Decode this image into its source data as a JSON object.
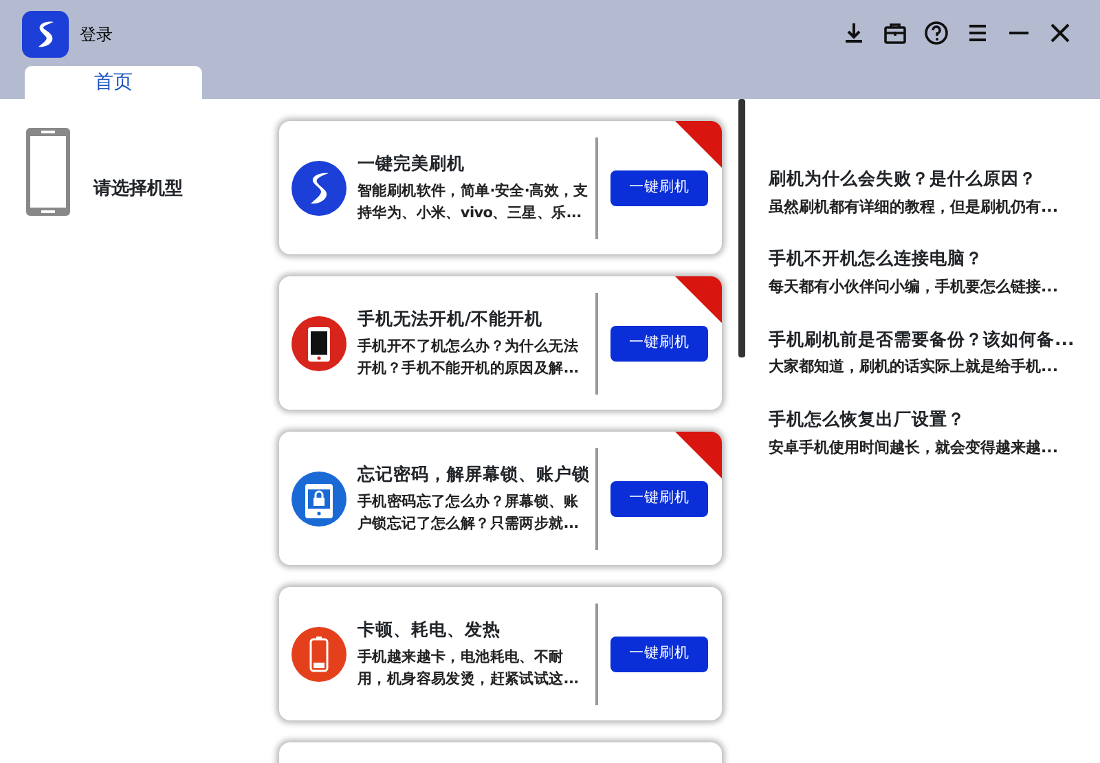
{
  "window": {
    "title": "登录"
  },
  "tabs": [
    {
      "label": "首页",
      "selected": true
    }
  ],
  "device": {
    "label": "请选择机型"
  },
  "cards": [
    {
      "kind": "logo",
      "title": "一键完美刷机",
      "description": "智能刷机软件，简单·安全·高效，支持华为、小米、vivo、三星、乐...",
      "button": "一键刷机",
      "hot": true
    },
    {
      "kind": "phone",
      "title": "手机无法开机/不能开机",
      "description": "手机开不了机怎么办？为什么无法开机？手机不能开机的原因及解...",
      "button": "一键刷机",
      "hot": true
    },
    {
      "kind": "lock",
      "title": "忘记密码，解屏幕锁、账户锁",
      "description": "手机密码忘了怎么办？屏幕锁、账户锁忘记了怎么解？只需两步就...",
      "button": "一键刷机",
      "hot": true
    },
    {
      "kind": "battery",
      "title": "卡顿、耗电、发热",
      "description": "手机越来越卡，电池耗电、不耐用，机身容易发烫，赶紧试试这...",
      "button": "一键刷机",
      "hot": false
    }
  ],
  "articles": [
    {
      "title": "刷机为什么会失败？是什么原因？",
      "summary": "虽然刷机都有详细的教程，但是刷机仍有..."
    },
    {
      "title": "手机不开机怎么连接电脑？",
      "summary": "每天都有小伙伴问小编，手机要怎么链接..."
    },
    {
      "title": "手机刷机前是否需要备份？该如何备...",
      "summary": "大家都知道，刷机的话实际上就是给手机..."
    },
    {
      "title": "手机怎么恢复出厂设置？",
      "summary": "安卓手机使用时间越长，就会变得越来越..."
    }
  ]
}
